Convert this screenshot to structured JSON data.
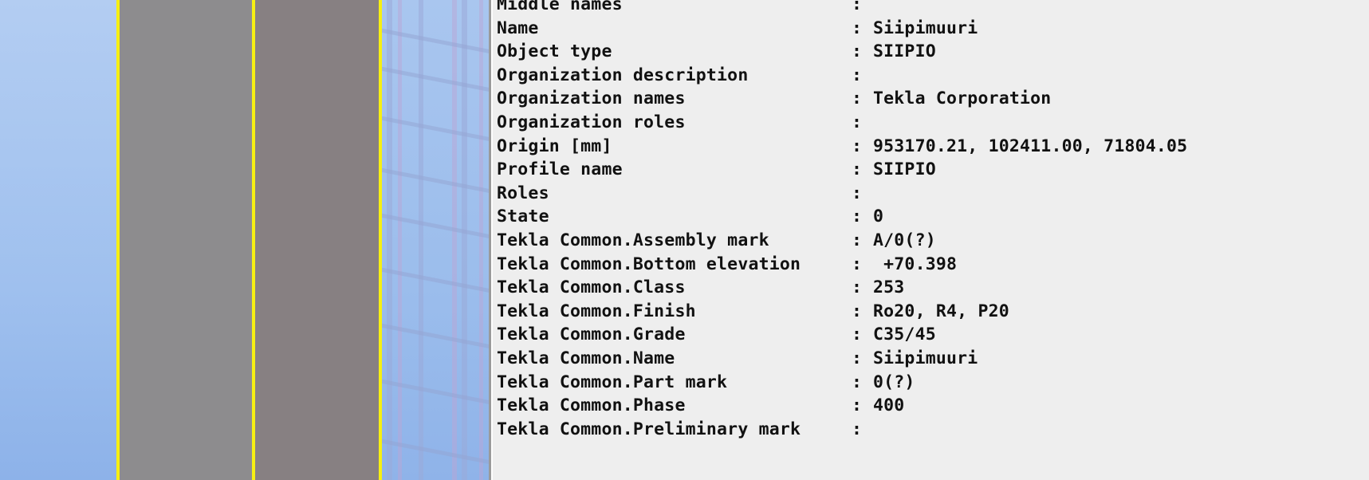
{
  "viewport": {
    "name": "tekla-3d-model-view",
    "colors": {
      "sky": "#a9c6ef",
      "wall_light": "#8d8c8e",
      "wall_dark": "#878082",
      "selection_highlight": "#f6ef12",
      "ghost_grid": "#9aa9d8",
      "ghost_grid_violet": "#b9a6d6"
    }
  },
  "panel": {
    "name": "object-inquire-properties",
    "background": "#eeeeee",
    "separator": ":",
    "rows": [
      {
        "key": "Middle names",
        "value": ""
      },
      {
        "key": "Name",
        "value": "Siipimuuri"
      },
      {
        "key": "Object type",
        "value": "SIIPIO"
      },
      {
        "key": "Organization description",
        "value": ""
      },
      {
        "key": "Organization names",
        "value": "Tekla Corporation"
      },
      {
        "key": "Organization roles",
        "value": ""
      },
      {
        "key": "Origin [mm]",
        "value": "953170.21, 102411.00, 71804.05"
      },
      {
        "key": "Profile name",
        "value": "SIIPIO"
      },
      {
        "key": "Roles",
        "value": ""
      },
      {
        "key": "State",
        "value": "0"
      },
      {
        "key": "Tekla Common.Assembly mark",
        "value": "A/0(?)"
      },
      {
        "key": "Tekla Common.Bottom elevation",
        "value": " +70.398"
      },
      {
        "key": "Tekla Common.Class",
        "value": "253"
      },
      {
        "key": "Tekla Common.Finish",
        "value": "Ro20, R4, P20"
      },
      {
        "key": "Tekla Common.Grade",
        "value": "C35/45"
      },
      {
        "key": "Tekla Common.Name",
        "value": "Siipimuuri"
      },
      {
        "key": "Tekla Common.Part mark",
        "value": "0(?)"
      },
      {
        "key": "Tekla Common.Phase",
        "value": "400"
      },
      {
        "key": "Tekla Common.Preliminary mark",
        "value": ""
      }
    ]
  }
}
